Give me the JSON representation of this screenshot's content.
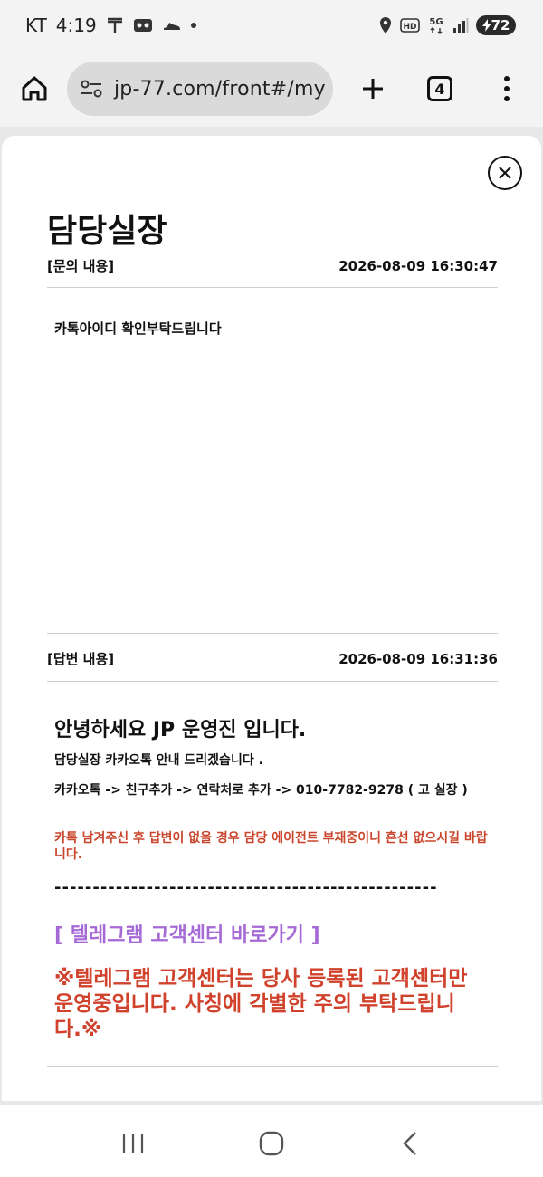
{
  "status_bar": {
    "carrier": "KT",
    "time": "4:19",
    "battery": "72",
    "icons": [
      "t-icon",
      "voicemail-icon",
      "shoe-icon",
      "location-icon",
      "hd-icon",
      "5g-icon",
      "signal-icon",
      "battery-icon"
    ]
  },
  "browser": {
    "url": "jp-77.com/front#/my",
    "tab_count": "4"
  },
  "modal": {
    "title": "담당실장",
    "inquiry_label": "[문의 내용]",
    "inquiry_time": "2026-08-09 16:30:47",
    "inquiry_text": "카톡아이디  확인부탁드립니다",
    "answer_label": "[답변 내용]",
    "answer_time": "2026-08-09 16:31:36",
    "answer": {
      "greeting": "안녕하세요 JP 운영진 입니다.",
      "line1": "담당실장 카카오톡 안내 드리겠습니다 .",
      "line2": "카카오톡 -> 친구추가 -> 연락처로 추가 -> 010-7782-9278 ( 고 실장 )",
      "line3": "카톡 남겨주신 후 답변이 없을 경우 담당 에이전트 부재중이니 혼선 없으시길 바랍니다.",
      "divider": "--------------------------------------------------",
      "telegram_link": "[ 텔레그램 고객센터 바로가기 ]",
      "warning": "※텔레그램 고객센터는 당사 등록된 고객센터만 운영중입니다. 사칭에 각별한 주의 부탁드립니다.※"
    }
  },
  "colors": {
    "warning_red": "#d0422c",
    "link_purple": "#a66ad6"
  }
}
